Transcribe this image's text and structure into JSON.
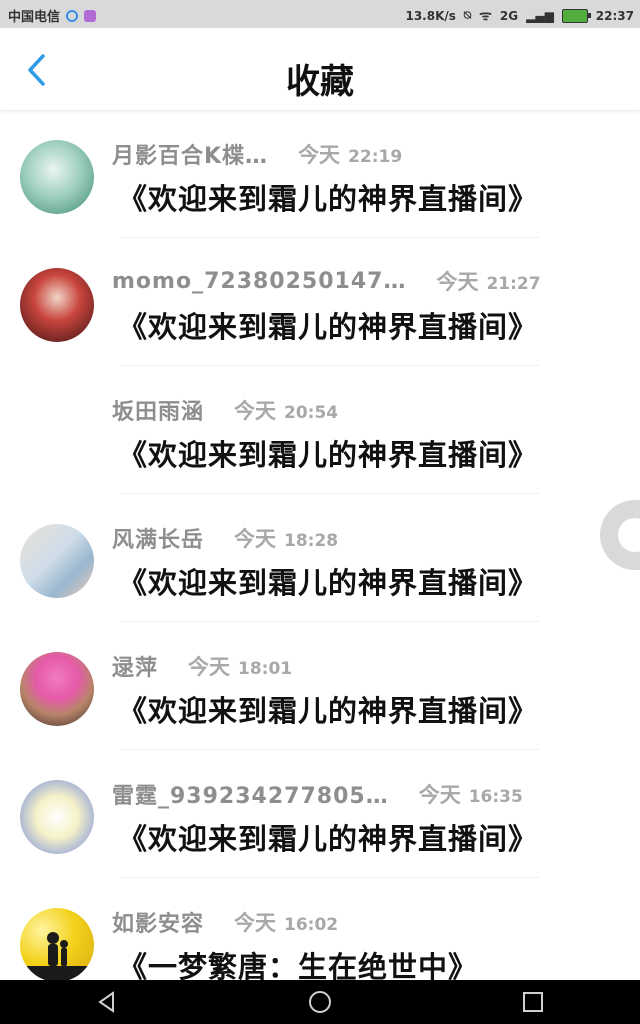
{
  "status_bar": {
    "carrier": "中国电信",
    "speed": "13.8K/s",
    "network": "2G",
    "time": "22:37"
  },
  "header": {
    "title": "收藏"
  },
  "items": [
    {
      "name": "月影百合K楪…",
      "day": "今天",
      "time": "22:19",
      "room": "《欢迎来到霜儿的神界直播间》",
      "avatar_colors": [
        "#cfe6df",
        "#3d8c6f"
      ]
    },
    {
      "name": "momo_72380250147…",
      "day": "今天",
      "time": "21:27",
      "room": "《欢迎来到霜儿的神界直播间》",
      "avatar_colors": [
        "#5a1c1c",
        "#c9453d"
      ]
    },
    {
      "name": "坂田雨涵",
      "day": "今天",
      "time": "20:54",
      "room": "《欢迎来到霜儿的神界直播间》",
      "avatar_colors": [
        "#ffffff",
        "#ffffff"
      ]
    },
    {
      "name": "风满长岳",
      "day": "今天",
      "time": "18:28",
      "room": "《欢迎来到霜儿的神界直播间》",
      "avatar_colors": [
        "#e9e2da",
        "#9ab6cf"
      ]
    },
    {
      "name": "逯萍",
      "day": "今天",
      "time": "18:01",
      "room": "《欢迎来到霜儿的神界直播间》",
      "avatar_colors": [
        "#e55aa9",
        "#3a2a25"
      ]
    },
    {
      "name": "雷霆_939234277805…",
      "day": "今天",
      "time": "16:35",
      "room": "《欢迎来到霜儿的神界直播间》",
      "avatar_colors": [
        "#f5f1c8",
        "#9aa8d8"
      ]
    },
    {
      "name": "如影安容",
      "day": "今天",
      "time": "16:02",
      "room": "《一梦繁唐：生在绝世中》",
      "avatar_colors": [
        "#f3d21b",
        "#1b1b1b"
      ]
    }
  ]
}
